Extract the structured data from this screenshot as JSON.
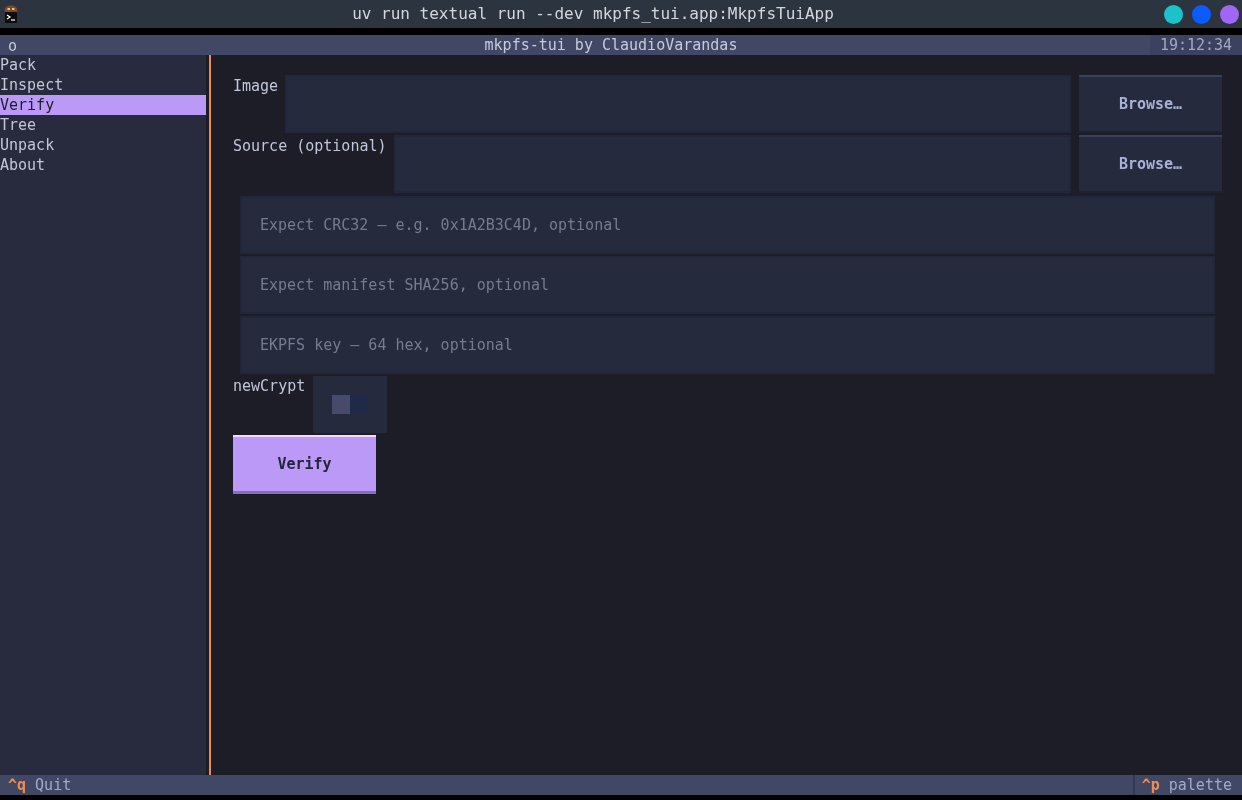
{
  "window": {
    "title": "uv run textual run --dev mkpfs_tui.app:MkpfsTuiApp"
  },
  "header": {
    "icon": "o",
    "title": "mkpfs-tui by ClaudioVarandas",
    "clock": "19:12:34"
  },
  "sidebar": {
    "items": [
      {
        "label": "Pack",
        "selected": false
      },
      {
        "label": "Inspect",
        "selected": false
      },
      {
        "label": "Verify",
        "selected": true
      },
      {
        "label": "Tree",
        "selected": false
      },
      {
        "label": "Unpack",
        "selected": false
      },
      {
        "label": "About",
        "selected": false
      }
    ]
  },
  "form": {
    "file_fields": [
      {
        "label": "Image",
        "button": "Browse…"
      },
      {
        "label": "Source (optional)",
        "button": "Browse…"
      }
    ],
    "text_fields": [
      {
        "placeholder": "Expect CRC32 — e.g. 0x1A2B3C4D, optional"
      },
      {
        "placeholder": "Expect manifest SHA256, optional"
      },
      {
        "placeholder": "EKPFS key — 64 hex, optional"
      }
    ],
    "switch": {
      "label": "newCrypt",
      "on": false
    },
    "submit_button": "Verify"
  },
  "footer": {
    "bindings": [
      {
        "key": "^q",
        "label": "Quit"
      }
    ],
    "palette": {
      "key": "^p",
      "label": "palette"
    }
  }
}
